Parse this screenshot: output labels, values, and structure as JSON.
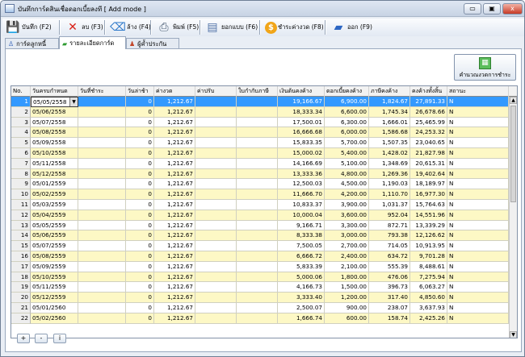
{
  "window": {
    "title": "บันทึกการ์ดสินเชื่อดอกเบี้ยลงที [ Add mode ]",
    "controls": [
      "▭",
      "▣",
      "x"
    ]
  },
  "toolbar": [
    {
      "key": "save",
      "label": "บันทึก (F2)",
      "icon": "floppy-disk-icon",
      "glyph": "💾"
    },
    {
      "key": "delete",
      "label": "ลบ (F3)",
      "icon": "delete-x-icon",
      "glyph": "✕"
    },
    {
      "key": "clear",
      "label": "ล้าง (F4)",
      "icon": "clear-eraser-icon",
      "glyph": "⌫"
    },
    {
      "key": "print",
      "label": "พิมพ์ (F5)",
      "icon": "printer-icon",
      "glyph": "⎙"
    },
    {
      "key": "copy",
      "label": "ยอกแบบ (F6)",
      "icon": "document-copy-icon",
      "glyph": "▤"
    },
    {
      "key": "pay",
      "label": "ชำระค่างวด (F8)",
      "icon": "payment-coin-icon",
      "glyph": "$"
    },
    {
      "key": "exit",
      "label": "ออก (F9)",
      "icon": "exit-book-icon",
      "glyph": "▰"
    }
  ],
  "tabs": [
    {
      "label": "การ์ดลูกหนี้",
      "icon": "debtor-card-icon",
      "active": false
    },
    {
      "label": "รายละเอียดการ์ด",
      "icon": "card-details-icon",
      "active": true
    },
    {
      "label": "ผู้ค้ำประกัน",
      "icon": "guarantor-icon",
      "active": false
    }
  ],
  "calc_button": {
    "label": "คำนวณงวดการชำระ",
    "icon": "calculator-icon"
  },
  "table": {
    "headers": [
      "No.",
      "วันครบกำหนด",
      "วันที่ชำระ",
      "วันล่าช้า",
      "ค่างวด",
      "ค่าปรับ",
      "ใบกำกับภาษี",
      "เงินต้นคงค้าง",
      "ดอกเบี้ยคงค้าง",
      "ภาษีคงค้าง",
      "คงค้างทั้งสิ้น",
      "สถานะ"
    ],
    "rows": [
      [
        "1",
        "05/05/2558",
        "",
        "0",
        "1,212.67",
        "",
        "",
        "19,166.67",
        "6,900.00",
        "1,824.67",
        "27,891.33",
        "N"
      ],
      [
        "2",
        "05/06/2558",
        "",
        "0",
        "1,212.67",
        "",
        "",
        "18,333.34",
        "6,600.00",
        "1,745.34",
        "26,678.66",
        "N"
      ],
      [
        "3",
        "05/07/2558",
        "",
        "0",
        "1,212.67",
        "",
        "",
        "17,500.01",
        "6,300.00",
        "1,666.01",
        "25,465.99",
        "N"
      ],
      [
        "4",
        "05/08/2558",
        "",
        "0",
        "1,212.67",
        "",
        "",
        "16,666.68",
        "6,000.00",
        "1,586.68",
        "24,253.32",
        "N"
      ],
      [
        "5",
        "05/09/2558",
        "",
        "0",
        "1,212.67",
        "",
        "",
        "15,833.35",
        "5,700.00",
        "1,507.35",
        "23,040.65",
        "N"
      ],
      [
        "6",
        "05/10/2558",
        "",
        "0",
        "1,212.67",
        "",
        "",
        "15,000.02",
        "5,400.00",
        "1,428.02",
        "21,827.98",
        "N"
      ],
      [
        "7",
        "05/11/2558",
        "",
        "0",
        "1,212.67",
        "",
        "",
        "14,166.69",
        "5,100.00",
        "1,348.69",
        "20,615.31",
        "N"
      ],
      [
        "8",
        "05/12/2558",
        "",
        "0",
        "1,212.67",
        "",
        "",
        "13,333.36",
        "4,800.00",
        "1,269.36",
        "19,402.64",
        "N"
      ],
      [
        "9",
        "05/01/2559",
        "",
        "0",
        "1,212.67",
        "",
        "",
        "12,500.03",
        "4,500.00",
        "1,190.03",
        "18,189.97",
        "N"
      ],
      [
        "10",
        "05/02/2559",
        "",
        "0",
        "1,212.67",
        "",
        "",
        "11,666.70",
        "4,200.00",
        "1,110.70",
        "16,977.30",
        "N"
      ],
      [
        "11",
        "05/03/2559",
        "",
        "0",
        "1,212.67",
        "",
        "",
        "10,833.37",
        "3,900.00",
        "1,031.37",
        "15,764.63",
        "N"
      ],
      [
        "12",
        "05/04/2559",
        "",
        "0",
        "1,212.67",
        "",
        "",
        "10,000.04",
        "3,600.00",
        "952.04",
        "14,551.96",
        "N"
      ],
      [
        "13",
        "05/05/2559",
        "",
        "0",
        "1,212.67",
        "",
        "",
        "9,166.71",
        "3,300.00",
        "872.71",
        "13,339.29",
        "N"
      ],
      [
        "14",
        "05/06/2559",
        "",
        "0",
        "1,212.67",
        "",
        "",
        "8,333.38",
        "3,000.00",
        "793.38",
        "12,126.62",
        "N"
      ],
      [
        "15",
        "05/07/2559",
        "",
        "0",
        "1,212.67",
        "",
        "",
        "7,500.05",
        "2,700.00",
        "714.05",
        "10,913.95",
        "N"
      ],
      [
        "16",
        "05/08/2559",
        "",
        "0",
        "1,212.67",
        "",
        "",
        "6,666.72",
        "2,400.00",
        "634.72",
        "9,701.28",
        "N"
      ],
      [
        "17",
        "05/09/2559",
        "",
        "0",
        "1,212.67",
        "",
        "",
        "5,833.39",
        "2,100.00",
        "555.39",
        "8,488.61",
        "N"
      ],
      [
        "18",
        "05/10/2559",
        "",
        "0",
        "1,212.67",
        "",
        "",
        "5,000.06",
        "1,800.00",
        "476.06",
        "7,275.94",
        "N"
      ],
      [
        "19",
        "05/11/2559",
        "",
        "0",
        "1,212.67",
        "",
        "",
        "4,166.73",
        "1,500.00",
        "396.73",
        "6,063.27",
        "N"
      ],
      [
        "20",
        "05/12/2559",
        "",
        "0",
        "1,212.67",
        "",
        "",
        "3,333.40",
        "1,200.00",
        "317.40",
        "4,850.60",
        "N"
      ],
      [
        "21",
        "05/01/2560",
        "",
        "0",
        "1,212.67",
        "",
        "",
        "2,500.07",
        "900.00",
        "238.07",
        "3,637.93",
        "N"
      ],
      [
        "22",
        "05/02/2560",
        "",
        "0",
        "1,212.67",
        "",
        "",
        "1,666.74",
        "600.00",
        "158.74",
        "2,425.26",
        "N"
      ]
    ]
  },
  "bottom_buttons": [
    {
      "label": "+",
      "name": "add-row-button"
    },
    {
      "label": "-",
      "name": "remove-row-button"
    },
    {
      "label": "i",
      "name": "row-info-button"
    }
  ]
}
